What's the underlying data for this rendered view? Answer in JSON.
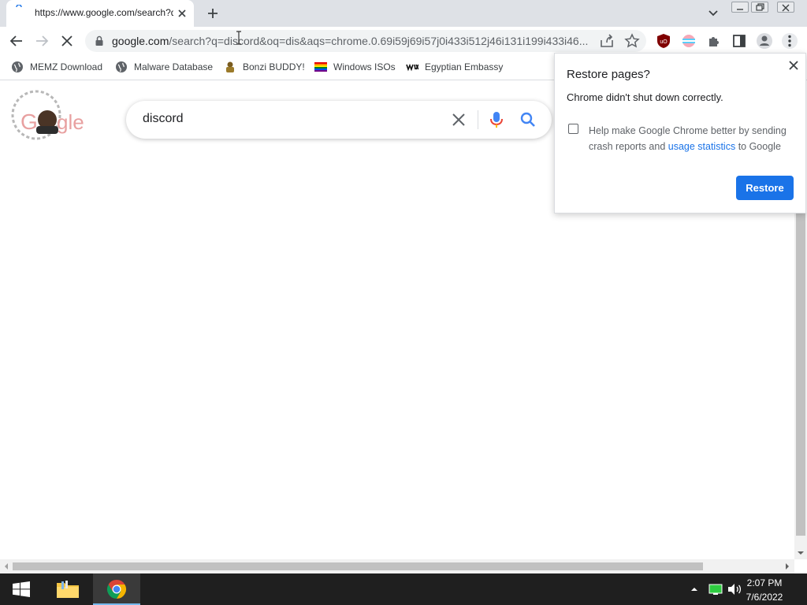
{
  "tab": {
    "title": "https://www.google.com/search?q=discord"
  },
  "omnibox": {
    "host": "google.com",
    "path": "/search?q=discord&oq=dis&aqs=chrome.0.69i59j69i57j0i433i512j46i131i199i433i46..."
  },
  "bookmarks": [
    {
      "label": "MEMZ Download"
    },
    {
      "label": "Malware Database"
    },
    {
      "label": "Bonzi BUDDY!"
    },
    {
      "label": "Windows ISOs"
    },
    {
      "label": "Egyptian Embassy"
    }
  ],
  "search": {
    "query": "discord"
  },
  "popup": {
    "title": "Restore pages?",
    "message": "Chrome didn't shut down correctly.",
    "help_prefix": "Help make Google Chrome better by sending crash reports and ",
    "help_link": "usage statistics",
    "help_suffix": " to Google",
    "restore_label": "Restore"
  },
  "taskbar": {
    "time": "2:07 PM",
    "date": "7/6/2022"
  },
  "colors": {
    "accent": "#1a73e8",
    "tabstrip": "#dee1e6",
    "taskbar": "#1f1f1f"
  }
}
